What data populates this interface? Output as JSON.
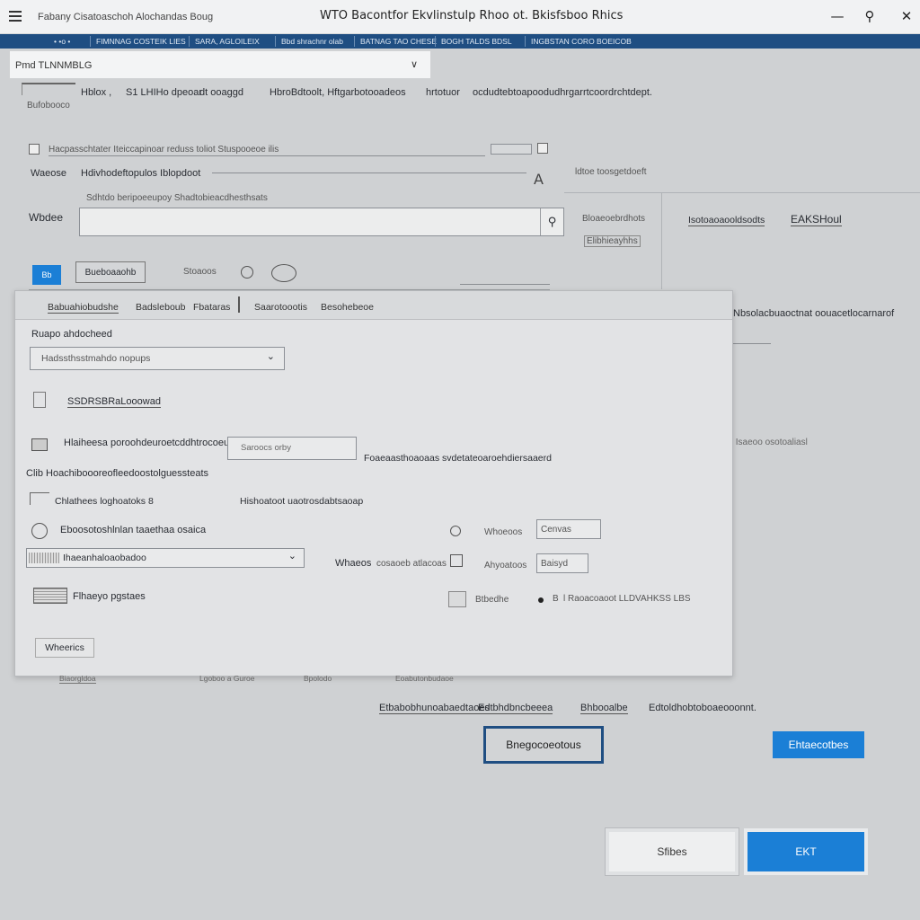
{
  "titlebar": {
    "app_title": "Fabany Cisatoaschoh Alochandas Boug",
    "window_title": "WTO Bacontfor Ekvlinstulp Rhoo ot. Bkisfsboo Rhics",
    "minimize_glyph": "—",
    "search_glyph": "⚲",
    "close_glyph": "✕"
  },
  "ribbon": {
    "tabs": [
      "• •o •",
      "FIMNNAG COSTEIK LIES",
      "SARA, AGLOILEIX",
      "Bbd shrachnr olab",
      "BATNAG TAO CHESE",
      "BOGH TALDS BDSL",
      "INGBSTAN CORO BOEICOB"
    ]
  },
  "top": {
    "dropdown_value": "Pmd  TLNNMBLG",
    "dropdown_chevron": "∨",
    "row1_a": "Bufobooco",
    "row1_b": "Hblox ,",
    "row1_c": "S1 LHIHo dpeoar",
    "row1_d": "dt ooaggd",
    "row1_e": "HbroBdtoolt, Hftgarbotooadeos",
    "row1_f": "hrtotuor",
    "row1_g": "ocdudtebtoapoodudhrgarrtcoordrchtdept.",
    "checkbox_label": "Hacpasschtater Iteiccapinoar reduss toliot Stuspooeoe ilis",
    "row3_label": "Waeose",
    "row3_text": "Hdivhodeftopulos Iblopdoot",
    "font_glyph": "A",
    "right_small": "ldtoe toosgetdoeft",
    "hint": "Sdhtdo beripoeeupoy Shadtobieacdhesthsats",
    "where_label": "Wbdee",
    "right_col1": "Bloaeoebrdhots",
    "right_col2": "Elibhieayhhs",
    "right_col3": "Isotoaoaooldsodts",
    "right_col4": "EAKSHoul",
    "blue_icon": "Bb",
    "mid_btn": "Bueboaaohb",
    "mid_text": "Stoaoos",
    "side_text": "Nbsolacbuaoctnat oouacetlocarnarof"
  },
  "dialog": {
    "tabs": [
      "Babuahiobudshe",
      "Badsleboub",
      "Fbataras",
      "Saarotoootis",
      "Besohebeoe"
    ],
    "section_label": "Ruapo ahdocheed",
    "combo_value": "Hadssthsstmahdo nopups",
    "checkbox1": "SSDRSBRaLooowad",
    "row1_label": "Hlaiheesa poroohdeuroetcddhtrocoeu",
    "row1_input": "Saroocs orby",
    "row1_right": "Foaeaasthoaoaas svdetateoaroehdiersaaerd",
    "row2_text": "Clib Hoachiboooreofleedoostolguessteats",
    "row3_label": "Chlathees loghoatoks",
    "row3_num": "8",
    "row3_right": "Hishoatoot uaotrosdabtsaoap",
    "row4_label": "Eboosotoshlnlan taaethaa osaica",
    "row4_right_label": "Whoeoos",
    "row4_right_value": "Cenvas",
    "combo2_value": "Ihaeanhaloaobadoo",
    "row5_label": "Whaeos",
    "row5_text": "cosaoeb atlacoas",
    "row5_right_label": "Ahyoatoos",
    "row5_right_value": "Baisyd",
    "row6_label": "Flhaeyo pgstaes",
    "row6_right_label": "Btbedhe",
    "row6_right_b": "B",
    "row6_right_text": "l Raoacoaoot LLDVAHKSS LBS",
    "footer_btn": "Wheerics"
  },
  "below": {
    "strip_labels": [
      "Biaorgldoa",
      "Lgoboo a Guroe",
      "Bpolodo",
      "Eoabutonbudaoe"
    ],
    "link1": "Etbabobhunoabaedtaoes",
    "link2": "Edtbhdbncbeeea",
    "link3": "Bhbooalbe",
    "link4": "Edtoldhobtoboaeooonnt.",
    "focused_btn": "Bnegocoeotous",
    "primary_btn": "Ehtaecotbes",
    "cancel_btn": "Sfibes",
    "ok_btn": "EKT"
  },
  "colors": {
    "ribbon": "#1f4e82",
    "accent": "#1b7fd6",
    "focus_border": "#1f4e82"
  }
}
